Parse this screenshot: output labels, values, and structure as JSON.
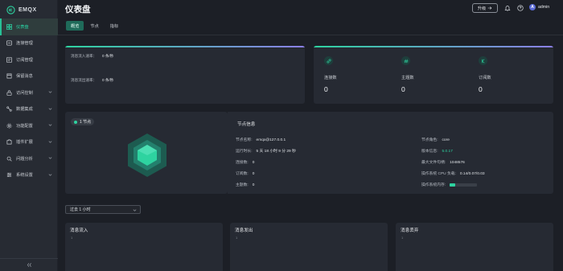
{
  "brand": {
    "name": "EMQX"
  },
  "sidebar": {
    "items": [
      {
        "label": "仪表盘",
        "active": true,
        "expandable": false,
        "icon": "dashboard-icon"
      },
      {
        "label": "连接管理",
        "expandable": false,
        "icon": "connection-icon"
      },
      {
        "label": "订阅管理",
        "expandable": false,
        "icon": "subscription-icon"
      },
      {
        "label": "保留消息",
        "expandable": false,
        "icon": "retained-icon"
      },
      {
        "label": "访问控制",
        "expandable": true,
        "icon": "lock-icon"
      },
      {
        "label": "数据集成",
        "expandable": true,
        "icon": "integration-icon"
      },
      {
        "label": "功能配置",
        "expandable": true,
        "icon": "gear-icon"
      },
      {
        "label": "插件扩展",
        "expandable": true,
        "icon": "plugin-icon"
      },
      {
        "label": "问题分析",
        "expandable": true,
        "icon": "analysis-icon"
      },
      {
        "label": "系统设置",
        "expandable": true,
        "icon": "settings-icon"
      }
    ]
  },
  "header": {
    "title": "仪表盘",
    "upgrade_label": "升级",
    "username": "admin",
    "avatar_letter": "A"
  },
  "tabs": [
    {
      "label": "概览",
      "active": true
    },
    {
      "label": "节点"
    },
    {
      "label": "指标"
    }
  ],
  "rates": {
    "in_label": "消息流入速率：",
    "in_value": "0 条/秒",
    "out_label": "消息流出速率：",
    "out_value": "0 条/秒"
  },
  "metrics": [
    {
      "label": "连接数",
      "value": "0",
      "icon": "link-icon"
    },
    {
      "label": "主题数",
      "value": "0",
      "icon": "hash-icon"
    },
    {
      "label": "订阅数",
      "value": "0",
      "icon": "subscribe-icon"
    }
  ],
  "node": {
    "badge": "1 节点",
    "info_title": "节点信息",
    "left": [
      {
        "label": "节点名称:",
        "value": "emqx@127.0.0.1"
      },
      {
        "label": "运行时长:",
        "value": "5 天 18 小时 9 分 29 秒"
      },
      {
        "label": "连接数:",
        "value": "0"
      },
      {
        "label": "订阅数:",
        "value": "0"
      },
      {
        "label": "主题数:",
        "value": "0"
      }
    ],
    "right": [
      {
        "label": "节点角色:",
        "value": "core"
      },
      {
        "label": "版本信息:",
        "value": "5.0.17"
      },
      {
        "label": "最大文件句柄:",
        "value": "1048576"
      },
      {
        "label": "操作系统 CPU 负载:",
        "value": "0.14/0.07/0.03"
      },
      {
        "label": "操作系统内存:"
      }
    ],
    "memory_usage": 0.2
  },
  "time_range": {
    "selected": "过去 1 小时"
  },
  "charts": [
    {
      "title": "消息流入",
      "tick": "1"
    },
    {
      "title": "消息发出",
      "tick": "1"
    },
    {
      "title": "消息丢弃",
      "tick": "1"
    }
  ],
  "colors": {
    "accent": "#2ed3a0",
    "accent_purple": "#8b7fe6"
  }
}
